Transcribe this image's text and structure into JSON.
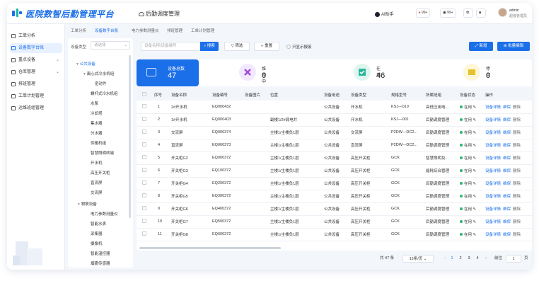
{
  "header": {
    "app_title": "医院数智后勤管理平台",
    "module_title": "后勤调度管理",
    "ai_label": "AI助手",
    "badge_alerts": "99+",
    "badge_messages": "99+",
    "user_name": "admin",
    "user_role": "超级管理员"
  },
  "sidebar": {
    "items": [
      {
        "label": "工单分析",
        "icon": "chart-icon"
      },
      {
        "label": "设备数字台账",
        "icon": "ledger-icon"
      },
      {
        "label": "重点设备",
        "icon": "key-device-icon"
      },
      {
        "label": "仓库管理",
        "icon": "warehouse-icon"
      },
      {
        "label": "排班管理",
        "icon": "schedule-icon"
      },
      {
        "label": "工单计划管理",
        "icon": "plan-icon"
      },
      {
        "label": "运维班组管理",
        "icon": "team-icon"
      }
    ]
  },
  "breadcrumbs": [
    "工单分析",
    "设备数字台账",
    "电力参数测量仪",
    "排班管理",
    "工单计划管理"
  ],
  "tree": {
    "label": "设备类型",
    "select_placeholder": "请选择",
    "nodes": [
      "公共设备",
      "离心式冷水机组",
      "密封件",
      "螺杆式冷水机组",
      "水泵",
      "冷却塔",
      "集水器",
      "分水器",
      "供暖机组",
      "智慧照明终端",
      "开水机",
      "高压开关柜",
      "直流屏",
      "交流屏",
      "物联设备",
      "电力参数测量仪",
      "智能水表",
      "采集器",
      "摄像机",
      "智能温控器",
      "烟雾传感器"
    ]
  },
  "toolbar": {
    "search_placeholder": "设备名称/设备编号",
    "search_label": "搜索",
    "filter_label": "筛选",
    "reset_label": "重置",
    "show_only_label": "只显示报废",
    "add_label": "新增",
    "batch_edit_label": "批量编辑"
  },
  "stats": {
    "total_label": "设备总数",
    "total_value": "47",
    "repair_label": "维修中",
    "repair_value": "0",
    "inuse_label": "在用",
    "inuse_value": "46",
    "disabled_label": "停用",
    "disabled_value": "0"
  },
  "table": {
    "headers": [
      "序号",
      "设备名称",
      "设备编号",
      "设备图片",
      "位置",
      "设备用途",
      "设备类型",
      "规格型号",
      "所属班组",
      "设备状态",
      "操作"
    ],
    "action_detail": "设备详情",
    "action_maintain": "维保",
    "action_delete": "删除",
    "rows": [
      {
        "no": "1",
        "name": "2#开水机",
        "code": "EQ000432",
        "location": "",
        "usage": "公共设备",
        "type": "开水机",
        "model": "KSJ—010",
        "team": "高低压用电...",
        "status": "在用"
      },
      {
        "no": "2",
        "name": "1#开水机",
        "code": "EQ000403",
        "location": "副楼1/2#弱电井",
        "usage": "公共设备",
        "type": "开水机",
        "model": "KSJ—001",
        "team": "后勤调度管理",
        "status": "在用"
      },
      {
        "no": "3",
        "name": "交流屏",
        "code": "EQ000374",
        "location": "主楼1/主楼负1层",
        "usage": "公共设备",
        "type": "交流屏",
        "model": "P2DW—DC2...",
        "team": "后勤调度管理",
        "status": "在用"
      },
      {
        "no": "4",
        "name": "直流屏",
        "code": "EQ000373",
        "location": "主楼1/主楼负1层",
        "usage": "公共设备",
        "type": "直流屏",
        "model": "P2DW—DC2...",
        "team": "后勤调度管理",
        "status": "在用"
      },
      {
        "no": "5",
        "name": "开关柜G2",
        "code": "EQ000372",
        "location": "主楼1/主楼负1层",
        "usage": "公共设备",
        "type": "高压开关柜",
        "model": "GCK",
        "team": "智慧照明及...",
        "status": "在用"
      },
      {
        "no": "6",
        "name": "开关柜G3",
        "code": "EQ100372",
        "location": "主楼1/主楼负1层",
        "usage": "公共设备",
        "type": "高压开关柜",
        "model": "GCK",
        "team": "能耗综合管理",
        "status": "在用"
      },
      {
        "no": "7",
        "name": "开关柜G4",
        "code": "EQ200372",
        "location": "主楼1/主楼负1层",
        "usage": "公共设备",
        "type": "高压开关柜",
        "model": "GCK",
        "team": "后勤调度管理",
        "status": "在用"
      },
      {
        "no": "8",
        "name": "开关柜G5",
        "code": "EQ300372",
        "location": "主楼1/主楼负1层",
        "usage": "公共设备",
        "type": "高压开关柜",
        "model": "GCK",
        "team": "后勤调度管理",
        "status": "在用"
      },
      {
        "no": "9",
        "name": "开关柜G6",
        "code": "EQ400372",
        "location": "主楼1/主楼负1层",
        "usage": "公共设备",
        "type": "高压开关柜",
        "model": "GCK",
        "team": "后勤调度管理",
        "status": "在用"
      },
      {
        "no": "10",
        "name": "开关柜G7",
        "code": "EQ500372",
        "location": "主楼1/主楼负1层",
        "usage": "公共设备",
        "type": "高压开关柜",
        "model": "GCK",
        "team": "后勤调度管理",
        "status": "在用"
      },
      {
        "no": "11",
        "name": "开关柜G8",
        "code": "EQ600372",
        "location": "主楼1/主楼负1层",
        "usage": "公共设备",
        "type": "高压开关柜",
        "model": "GCK",
        "team": "后勤调度管理",
        "status": "在用"
      }
    ]
  },
  "pager": {
    "total_text": "共 47 条",
    "page_size": "15条/页",
    "pages": [
      "1",
      "2",
      "3",
      "4"
    ],
    "goto_label": "前往",
    "goto_value": "1",
    "page_unit": "页"
  },
  "colors": {
    "primary": "#1b6fe8",
    "status_green": "#2bb673"
  }
}
